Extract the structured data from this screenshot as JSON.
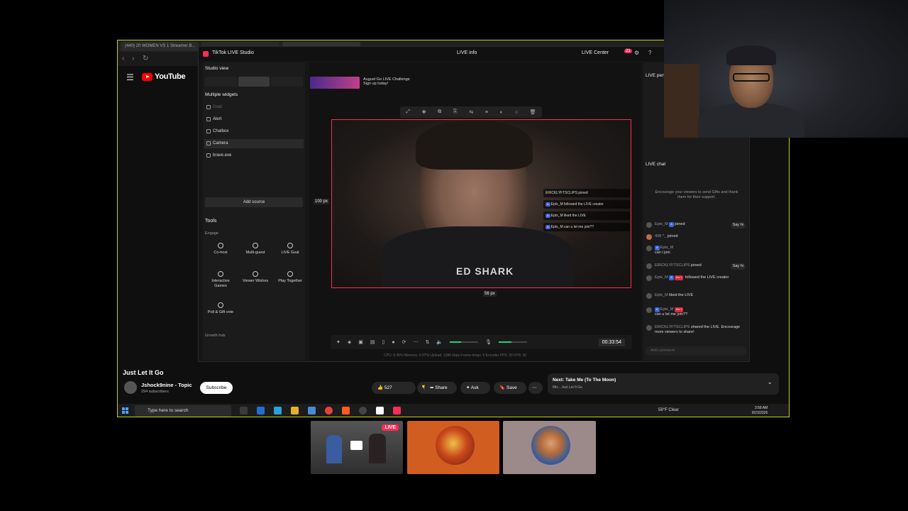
{
  "browser": {
    "tabs": [
      "(440) 20 WOMEN VS 1 Streamer B...",
      "",
      "",
      ""
    ],
    "yt_logo": "YouTube"
  },
  "studio": {
    "title": "TikTok LIVE Studio",
    "live_info": "LIVE info",
    "live_center": "LIVE Center",
    "notif_count": "21",
    "studio_view": "Studio view",
    "multiple_widgets": "Multiple widgets",
    "sources": [
      "Goal",
      "Alert",
      "Chatbox",
      "Camera",
      "brave.exe"
    ],
    "add_source": "Add source",
    "tools_title": "Tools",
    "engage_label": "Engage",
    "tools": [
      {
        "label": "Co-host",
        "icon": "link-icon"
      },
      {
        "label": "Multi-guest",
        "icon": "people-icon"
      },
      {
        "label": "LIVE Goal",
        "icon": "target-icon"
      },
      {
        "label": "Interactive Games",
        "icon": "gamepad-icon"
      },
      {
        "label": "Viewer Wishes",
        "icon": "gift-icon"
      },
      {
        "label": "Play Together",
        "icon": "play-together-icon"
      },
      {
        "label": "Poll & Gift vote",
        "icon": "poll-icon"
      }
    ],
    "growth_label": "Growth hub",
    "banner_text": "August Go LIVE Challenge",
    "banner_sub": "Sign up today!",
    "px_left": "100 px",
    "px_bottom": "56 px",
    "shirt_text": "ED SHARK",
    "timer": "00:33:54",
    "stats": "CPU: 6.45%   Memory: 0.07%   Upload: 1396 kbps   Frame drops: 0   Encoder FPS: 30   FPS: 30"
  },
  "overlay_chat": [
    {
      "name": "ERICKLYFTSCLIPS",
      "text": "joined"
    },
    {
      "name": "Eptx_M",
      "text": "followed the LIVE creator"
    },
    {
      "name": "Eptx_M",
      "text": "liked the LIVE"
    },
    {
      "name": "Eptx_M",
      "text": "can u let me join??"
    }
  ],
  "right_panel": {
    "title": "LIVE perf",
    "chat_title": "LIVE chat",
    "encourage": "Encourage your viewers to send Gifts and thank them for their support.",
    "chat": [
      {
        "name": "Eptx_M",
        "text": "joined",
        "sayhi": "Say hi"
      },
      {
        "name": "408 ^_",
        "text": "joined",
        "sayhi": ""
      },
      {
        "name": "Eptx_M",
        "text": "can i join",
        "sayhi": ""
      },
      {
        "name": "ERICKLYFTSCLIPS",
        "text": "joined",
        "sayhi": "Say hi"
      },
      {
        "name": "Eptx_M",
        "text": "followed the LIVE creator",
        "sayhi": ""
      },
      {
        "name": "Eptx_M",
        "text": "liked the LIVE",
        "sayhi": ""
      },
      {
        "name": "Eptx_M",
        "text": "can u let me join??",
        "sayhi": ""
      },
      {
        "name": "ERICKLYFTSCLIPS",
        "text": "shared the LIVE. Encourage more viewers to share!",
        "sayhi": ""
      }
    ],
    "add_comment": "Add comment"
  },
  "youtube": {
    "video_title": "Just Let It Go",
    "channel": "Jshock9nine - Topic",
    "subscribers": "294 subscribers",
    "subscribe": "Subscribe",
    "likes": "527",
    "share": "Share",
    "ask": "Ask",
    "save": "Save",
    "next_title": "Next: Take Me (To The Moon)",
    "next_sub": "Mix - Just Let It Go"
  },
  "taskbar": {
    "search_placeholder": "Type here to search",
    "weather": "59°F  Clear",
    "time": "3:58 AM",
    "date": "8/23/2026"
  },
  "bottom": {
    "live_badge": "LIVE"
  },
  "colors": {
    "tiktok_pink": "#fe2c55",
    "youtube_red": "#ff0000",
    "outline_yellow": "#c9d300"
  }
}
